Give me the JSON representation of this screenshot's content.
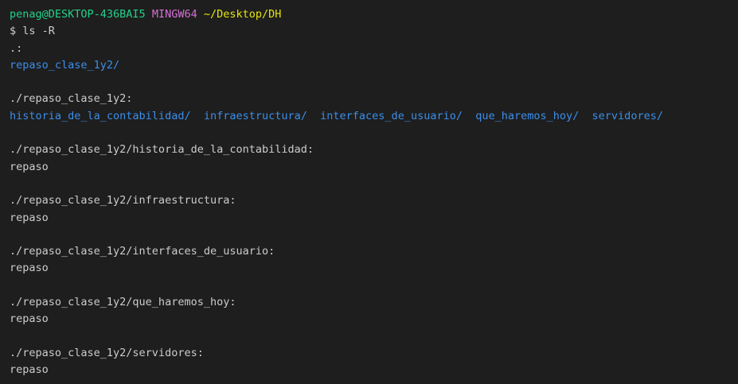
{
  "colors": {
    "background": "#1e1e1e",
    "foreground": "#cccccc",
    "user_host": "#23d18b",
    "system": "#d670d6",
    "path": "#e5e510",
    "directory": "#3b8eea"
  },
  "prompt": {
    "user_host": "penag@DESKTOP-436BAI5",
    "system": "MINGW64",
    "path": "~/Desktop/DH",
    "command": "$ ls -R"
  },
  "output": {
    "root_header": ".:",
    "root_entries": [
      "repaso_clase_1y2/"
    ],
    "sections": [
      {
        "header": "./repaso_clase_1y2:",
        "entries": [
          "historia_de_la_contabilidad/",
          "infraestructura/",
          "interfaces_de_usuario/",
          "que_haremos_hoy/",
          "servidores/"
        ],
        "entries_are_dirs": true
      },
      {
        "header": "./repaso_clase_1y2/historia_de_la_contabilidad:",
        "entries": [
          "repaso"
        ],
        "entries_are_dirs": false
      },
      {
        "header": "./repaso_clase_1y2/infraestructura:",
        "entries": [
          "repaso"
        ],
        "entries_are_dirs": false
      },
      {
        "header": "./repaso_clase_1y2/interfaces_de_usuario:",
        "entries": [
          "repaso"
        ],
        "entries_are_dirs": false
      },
      {
        "header": "./repaso_clase_1y2/que_haremos_hoy:",
        "entries": [
          "repaso"
        ],
        "entries_are_dirs": false
      },
      {
        "header": "./repaso_clase_1y2/servidores:",
        "entries": [
          "repaso"
        ],
        "entries_are_dirs": false
      }
    ]
  }
}
